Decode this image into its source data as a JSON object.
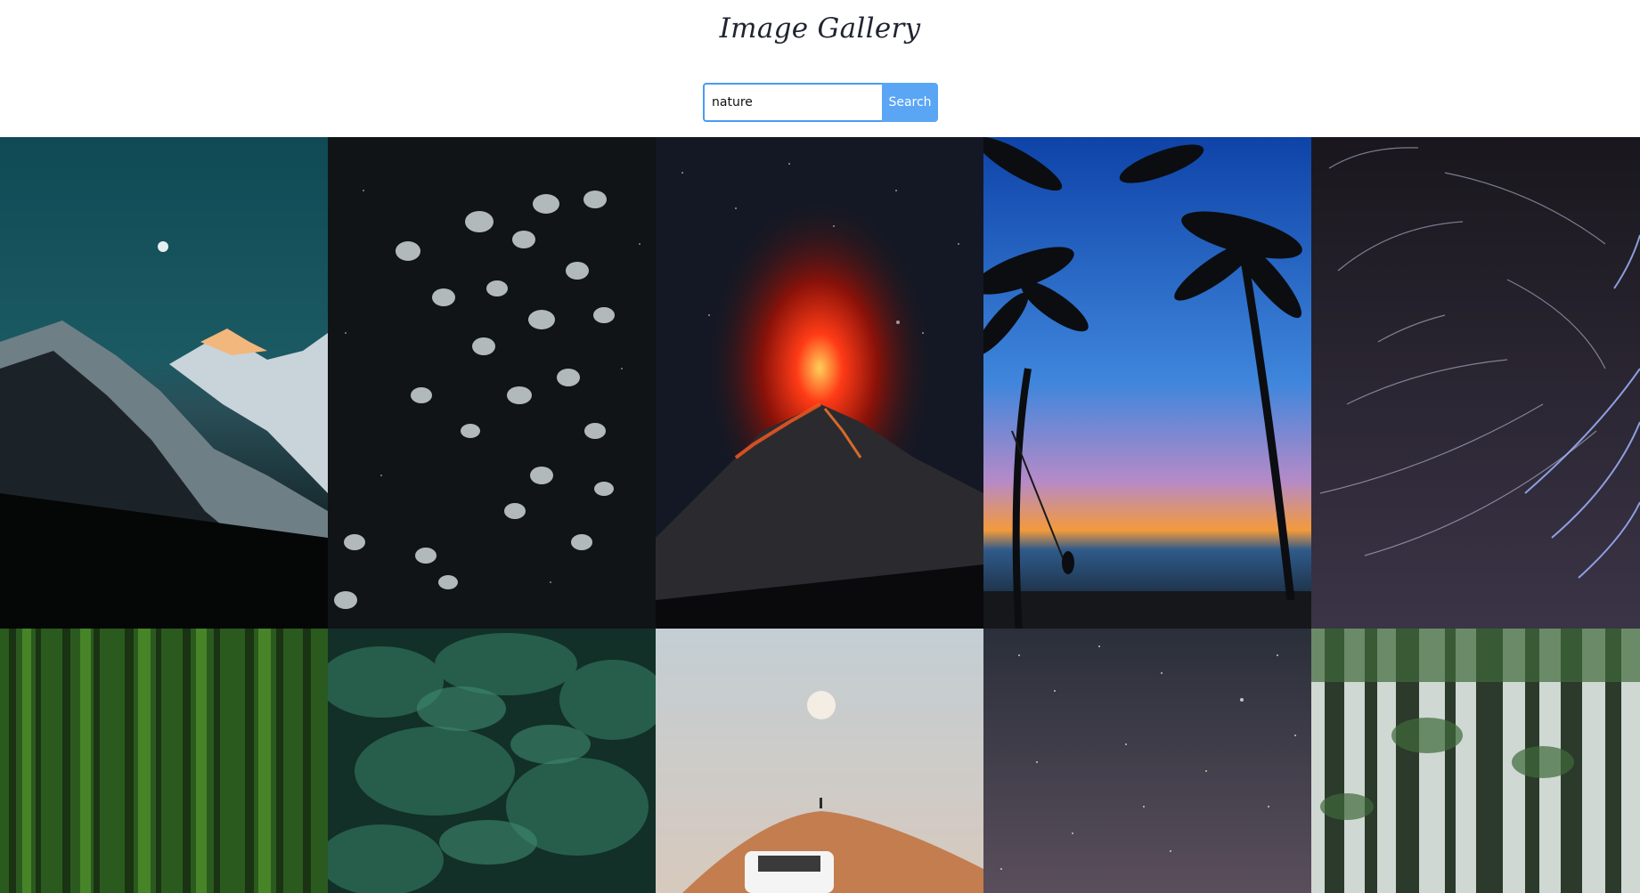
{
  "header": {
    "title": "Image Gallery"
  },
  "search": {
    "value": "nature",
    "button_label": "Search"
  },
  "gallery": {
    "images": [
      {
        "subject": "snowy mountains under moon"
      },
      {
        "subject": "jellyfish in dark water"
      },
      {
        "subject": "erupting volcano at night"
      },
      {
        "subject": "palm trees and rope swing at sunset"
      },
      {
        "subject": "star trails"
      },
      {
        "subject": "green forest"
      },
      {
        "subject": "evergreen tree canopy"
      },
      {
        "subject": "desert dune with car under moon"
      },
      {
        "subject": "starry night sky"
      },
      {
        "subject": "tall forest trees"
      }
    ]
  },
  "colors": {
    "accent": "#4a9af3",
    "button": "#5aa6f5"
  }
}
